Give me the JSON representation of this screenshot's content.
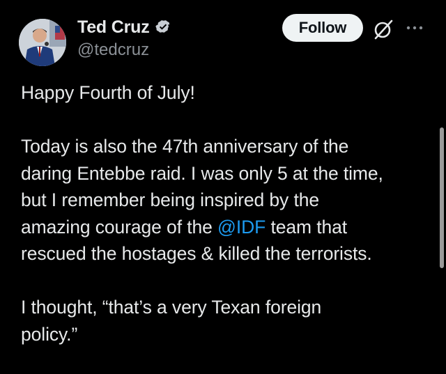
{
  "author": {
    "display_name": "Ted Cruz",
    "handle": "@tedcruz",
    "verified_badge": "verified-badge-icon"
  },
  "actions": {
    "follow_label": "Follow",
    "grok_icon": "grok-icon",
    "more_icon": "more-options-icon"
  },
  "tweet": {
    "line1": "Happy Fourth of July!",
    "p2_line1": "Today is also the 47th anniversary of the",
    "p2_line2": "daring Entebbe raid. I was only 5 at the time,",
    "p2_line3": "but I remember being inspired by the",
    "p2_line4_before": "amazing courage of the ",
    "p2_line4_mention": "@IDF",
    "p2_line4_after": " team that",
    "p2_line5": "rescued the hostages & killed the terrorists.",
    "p3_line1": "I thought, “that’s a very Texan foreign",
    "p3_line2": "policy.”"
  },
  "colors": {
    "background": "#000000",
    "text": "#e7e9ea",
    "secondary": "#8b9096",
    "link": "#1d9bf0",
    "button_bg": "#eff3f4"
  }
}
